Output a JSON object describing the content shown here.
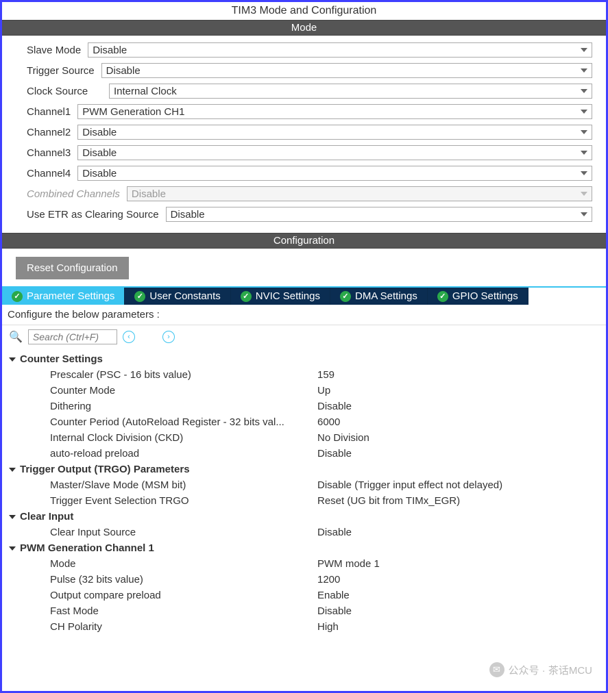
{
  "title": "TIM3 Mode and Configuration",
  "section_mode": "Mode",
  "section_config": "Configuration",
  "mode": {
    "slave_mode": {
      "label": "Slave Mode",
      "value": "Disable"
    },
    "trigger_source": {
      "label": "Trigger Source",
      "value": "Disable"
    },
    "clock_source": {
      "label": "Clock Source",
      "value": "Internal Clock"
    },
    "channel1": {
      "label": "Channel1",
      "value": "PWM Generation CH1"
    },
    "channel2": {
      "label": "Channel2",
      "value": "Disable"
    },
    "channel3": {
      "label": "Channel3",
      "value": "Disable"
    },
    "channel4": {
      "label": "Channel4",
      "value": "Disable"
    },
    "combined_channels": {
      "label": "Combined Channels",
      "value": "Disable"
    },
    "use_etr": {
      "label": "Use ETR as Clearing Source",
      "value": "Disable"
    }
  },
  "reset_button": "Reset Configuration",
  "tabs": {
    "param_settings": "Parameter Settings",
    "user_constants": "User Constants",
    "nvic_settings": "NVIC Settings",
    "dma_settings": "DMA Settings",
    "gpio_settings": "GPIO Settings"
  },
  "configure_label": "Configure the below parameters :",
  "search_placeholder": "Search (Ctrl+F)",
  "groups": {
    "counter_settings": {
      "title": "Counter Settings",
      "prescaler": {
        "label": "Prescaler (PSC - 16 bits value)",
        "value": "159"
      },
      "counter_mode": {
        "label": "Counter Mode",
        "value": "Up"
      },
      "dithering": {
        "label": "Dithering",
        "value": "Disable"
      },
      "counter_period": {
        "label": "Counter Period (AutoReload Register - 32 bits val...",
        "value": "6000"
      },
      "internal_clock_div": {
        "label": "Internal Clock Division (CKD)",
        "value": "No Division"
      },
      "auto_reload": {
        "label": "auto-reload preload",
        "value": "Disable"
      }
    },
    "trgo": {
      "title": "Trigger Output (TRGO) Parameters",
      "msm": {
        "label": "Master/Slave Mode (MSM bit)",
        "value": "Disable (Trigger input effect not delayed)"
      },
      "trgo_sel": {
        "label": "Trigger Event Selection TRGO",
        "value": "Reset (UG bit from TIMx_EGR)"
      }
    },
    "clear_input": {
      "title": "Clear Input",
      "source": {
        "label": "Clear Input Source",
        "value": "Disable"
      }
    },
    "pwm_ch1": {
      "title": "PWM Generation Channel 1",
      "mode": {
        "label": "Mode",
        "value": "PWM mode 1"
      },
      "pulse": {
        "label": "Pulse (32 bits value)",
        "value": "1200"
      },
      "ocp": {
        "label": "Output compare preload",
        "value": "Enable"
      },
      "fast_mode": {
        "label": "Fast Mode",
        "value": "Disable"
      },
      "ch_polarity": {
        "label": "CH Polarity",
        "value": "High"
      }
    }
  },
  "watermark": "公众号 · 茶话MCU"
}
